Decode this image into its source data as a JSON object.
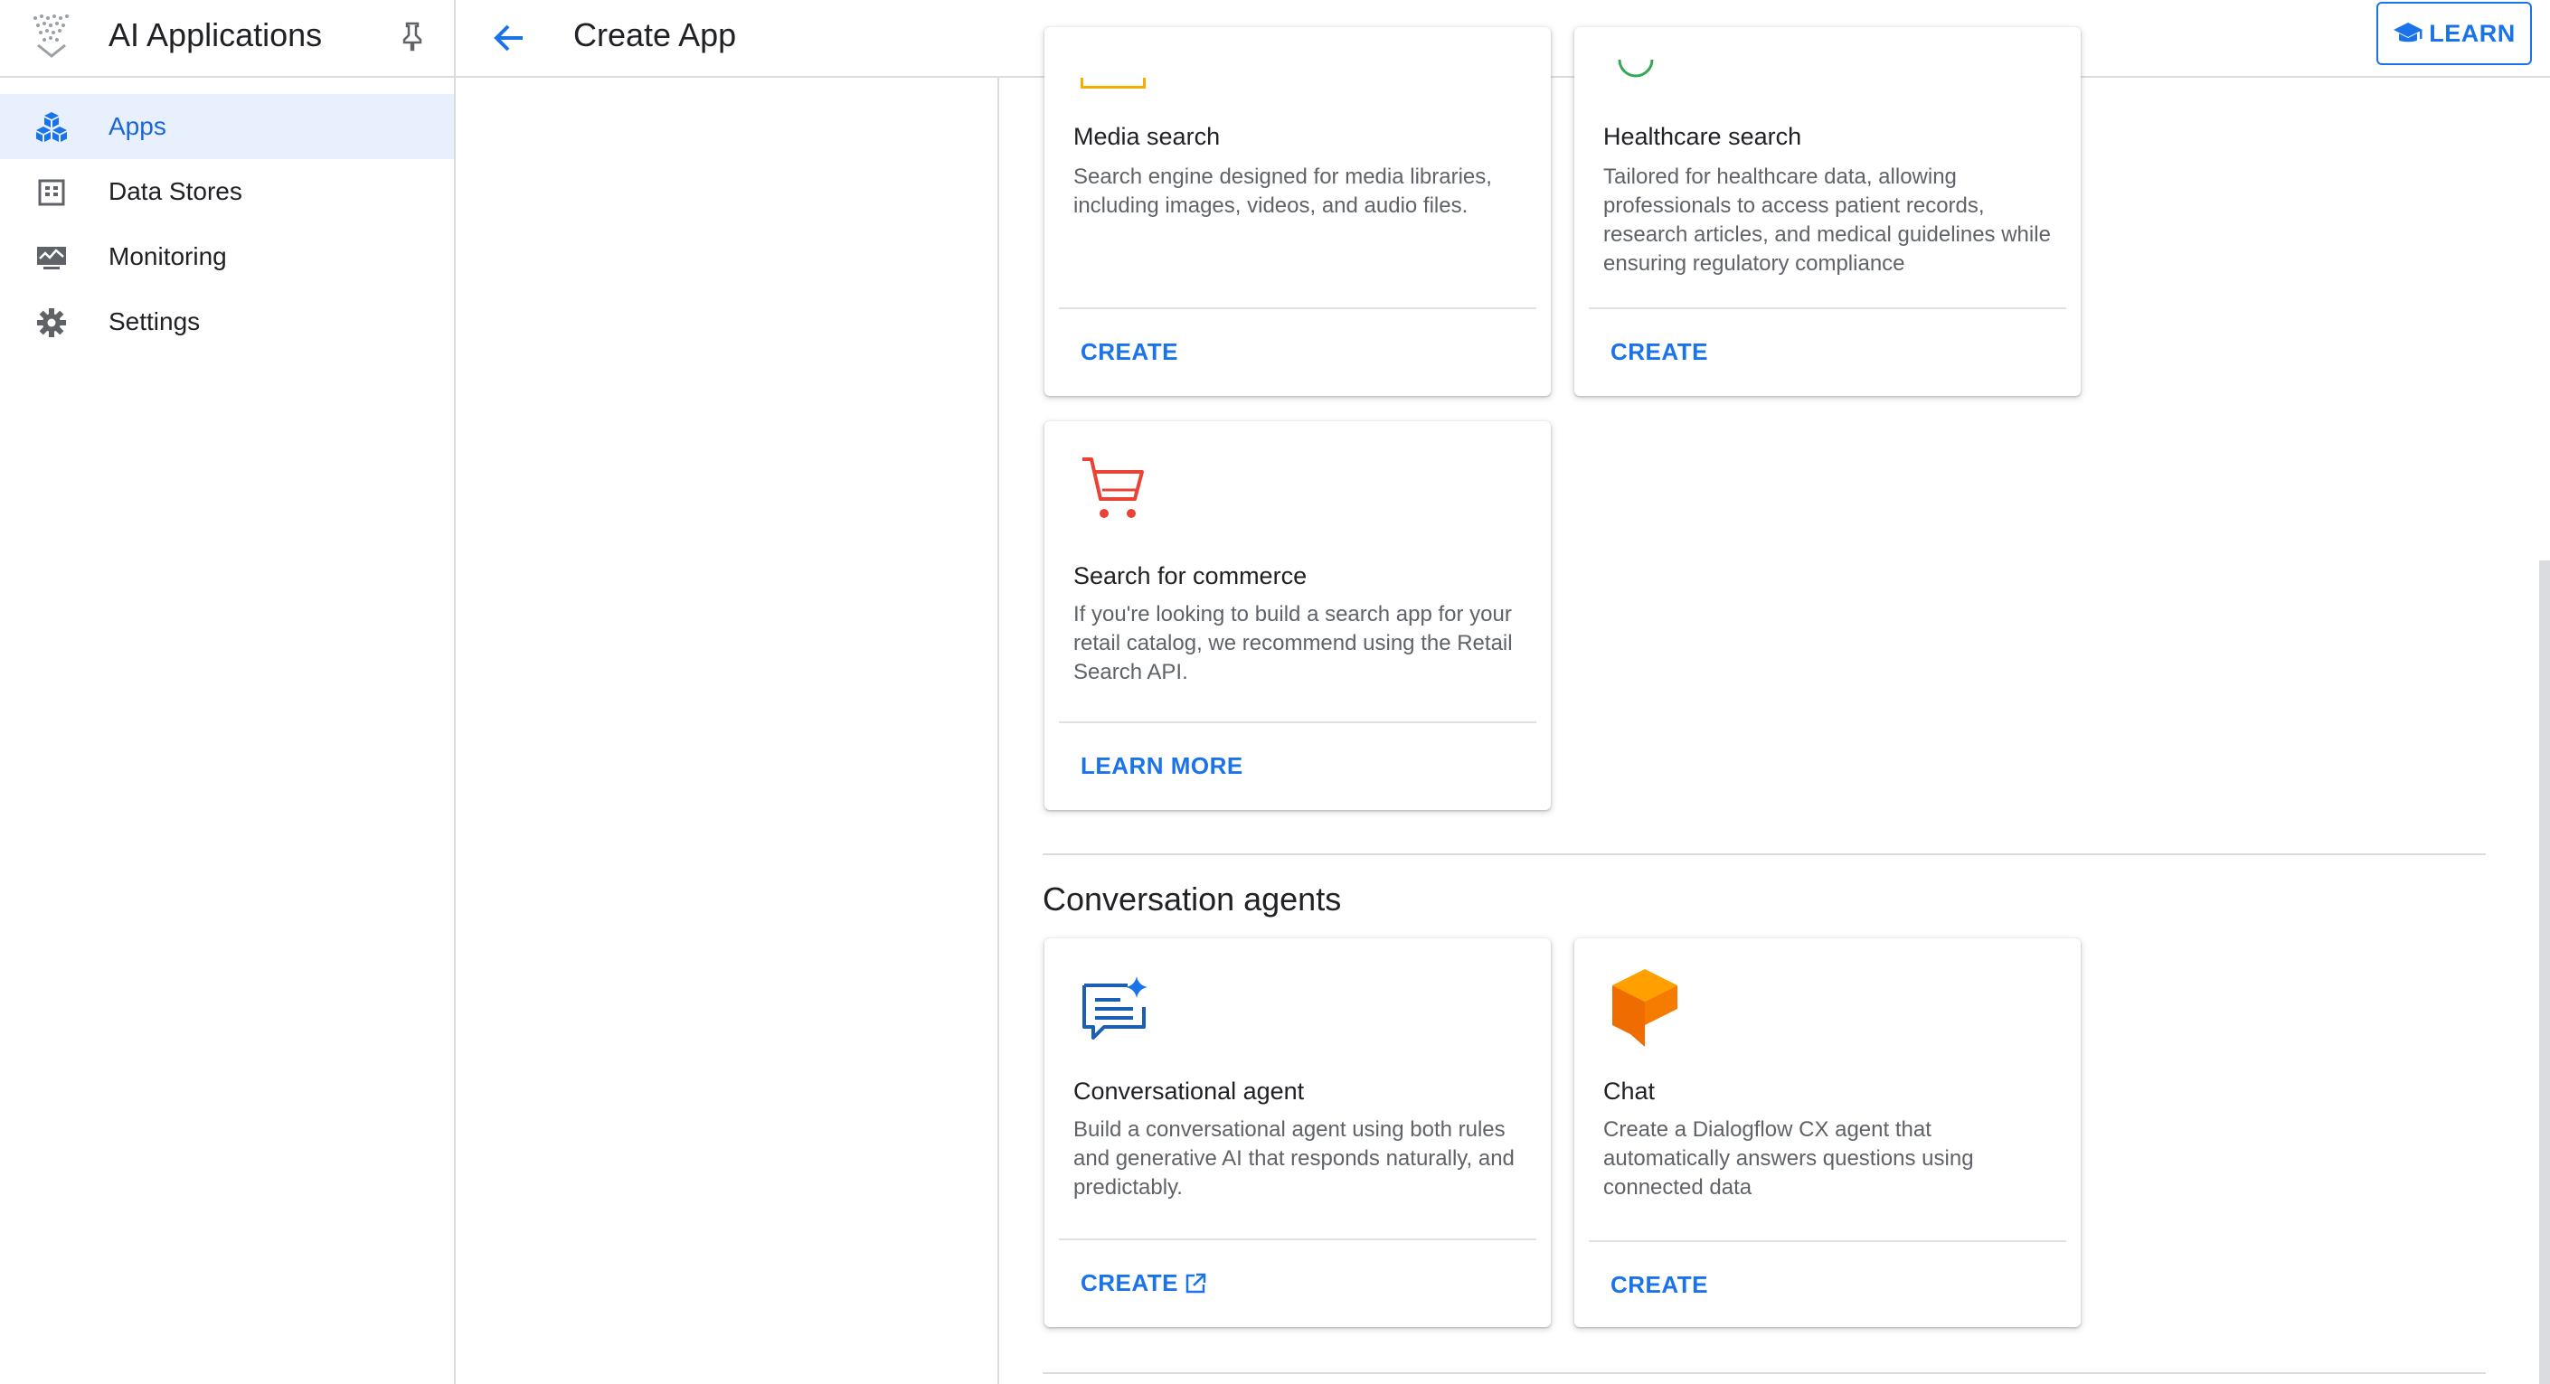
{
  "sidebar": {
    "product_name": "AI Applications",
    "items": [
      {
        "label": "Apps",
        "icon": "apps-cube-icon",
        "active": true
      },
      {
        "label": "Data Stores",
        "icon": "data-store-icon",
        "active": false
      },
      {
        "label": "Monitoring",
        "icon": "monitoring-icon",
        "active": false
      },
      {
        "label": "Settings",
        "icon": "settings-gear-icon",
        "active": false
      }
    ]
  },
  "header": {
    "title": "Create App",
    "learn_label": "LEARN"
  },
  "search_cards": [
    {
      "title": "Media search",
      "description": "Search engine designed for media libraries, including images, videos, and audio files.",
      "action": "CREATE"
    },
    {
      "title": "Healthcare search",
      "description": "Tailored for healthcare data, allowing professionals to access patient records, research articles, and medical guidelines while ensuring regulatory compliance",
      "action": "CREATE"
    },
    {
      "title": "Search for commerce",
      "description": "If you're looking to build a search app for your retail catalog, we recommend using the Retail Search API.",
      "action": "LEARN MORE"
    }
  ],
  "conversation_section": {
    "title": "Conversation agents",
    "cards": [
      {
        "title": "Conversational agent",
        "description": "Build a conversational agent using both rules and generative AI that responds naturally, and predictably.",
        "action": "CREATE"
      },
      {
        "title": "Chat",
        "description": "Create a Dialogflow CX agent that automatically answers questions using connected data",
        "action": "CREATE"
      }
    ]
  },
  "colors": {
    "accent": "#1a73e8",
    "active_nav_bg": "#e8f0fe",
    "cart_red": "#ea4335",
    "dialogflow_orange": "#ef6c00"
  }
}
